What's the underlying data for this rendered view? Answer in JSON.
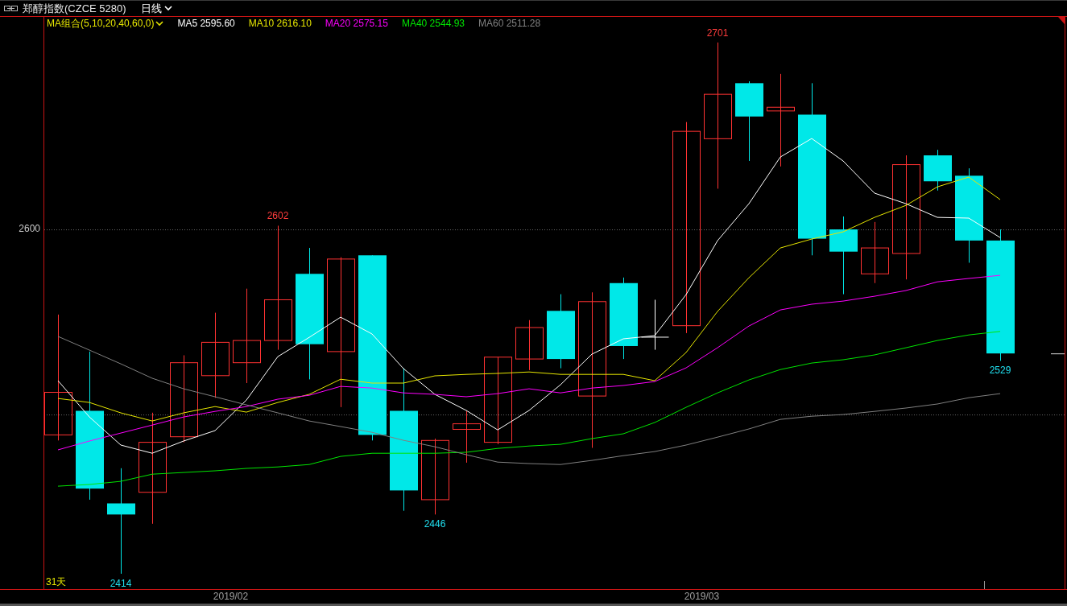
{
  "header": {
    "title": "郑醇指数(CZCE 5280)",
    "period": "日线"
  },
  "chart": {
    "legend_title": "MA组合(5,10,20,40,60,0)",
    "legend": [
      {
        "label": "MA5",
        "value": "2595.60",
        "color": "#ffffff"
      },
      {
        "label": "MA10",
        "value": "2616.10",
        "color": "#e6e600"
      },
      {
        "label": "MA20",
        "value": "2575.15",
        "color": "#ff00ff"
      },
      {
        "label": "MA40",
        "value": "2544.93",
        "color": "#00e600"
      },
      {
        "label": "MA60",
        "value": "2511.28",
        "color": "#808080"
      }
    ],
    "price_axis_label": "2600",
    "price_labels": [
      "2602",
      "2701",
      "2414",
      "2446",
      "2529"
    ],
    "bar_count_label": "31天",
    "date_axis": [
      "2019/02",
      "2019/03"
    ]
  }
}
